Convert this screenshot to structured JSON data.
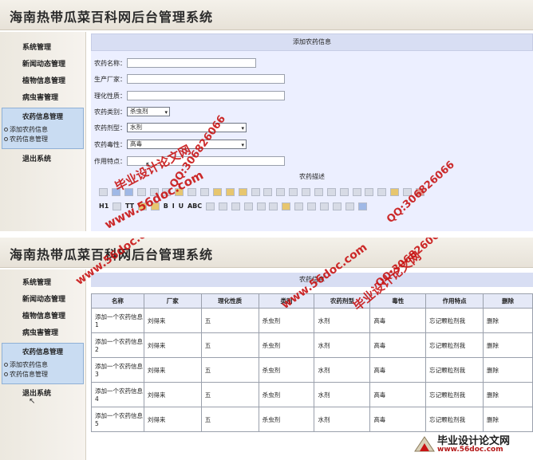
{
  "app": {
    "title": "海南热带瓜菜百科网后台管理系统"
  },
  "sidebar": {
    "system": "系统管理",
    "news": "新闻动态管理",
    "plants": "植物信息管理",
    "pests": "病虫害管理",
    "pesticide_group": "农药信息管理",
    "add_pesticide": "添加农药信息",
    "manage_pesticide": "农药信息管理",
    "logout": "退出系统"
  },
  "form": {
    "header": "添加农药信息",
    "name_label": "农药名称：",
    "maker_label": "生产厂家：",
    "property_label": "理化性质：",
    "type_label": "农药类别：",
    "type_value": "杀虫剂",
    "dosage_label": "农药剂型：",
    "dosage_value": "水剂",
    "toxicity_label": "农药毒性：",
    "toxicity_value": "高毒",
    "feature_label": "作用特点：",
    "description_title": "农药描述"
  },
  "list": {
    "header": "农药信息",
    "columns": [
      "名称",
      "厂家",
      "理化性质",
      "类别",
      "农药剂型",
      "毒性",
      "作用特点",
      "删除"
    ],
    "rows": [
      [
        "添加一个农药信息1",
        "刘得来",
        "五",
        "杀虫剂",
        "水剂",
        "高毒",
        "忘记颗粒剂我",
        "删除"
      ],
      [
        "添加一个农药信息2",
        "刘得来",
        "五",
        "杀虫剂",
        "水剂",
        "高毒",
        "忘记颗粒剂我",
        "删除"
      ],
      [
        "添加一个农药信息3",
        "刘得来",
        "五",
        "杀虫剂",
        "水剂",
        "高毒",
        "忘记颗粒剂我",
        "删除"
      ],
      [
        "添加一个农药信息4",
        "刘得来",
        "五",
        "杀虫剂",
        "水剂",
        "高毒",
        "忘记颗粒剂我",
        "删除"
      ],
      [
        "添加一个农药信息5",
        "刘得来",
        "五",
        "杀虫剂",
        "水剂",
        "高毒",
        "忘记颗粒剂我",
        "删除"
      ]
    ]
  },
  "watermarks": {
    "site_cn": "毕业设计论文网",
    "domain": "www.56doc.com",
    "qq": "QQ:306826066",
    "logo_cn": "毕业设计论文网",
    "logo_domain": "www.56doc.com"
  },
  "colors": {
    "banner": "#ece8df",
    "sidebar_group": "#c9dcf2",
    "form_bg": "#ecefff",
    "watermark": "#c81414"
  }
}
